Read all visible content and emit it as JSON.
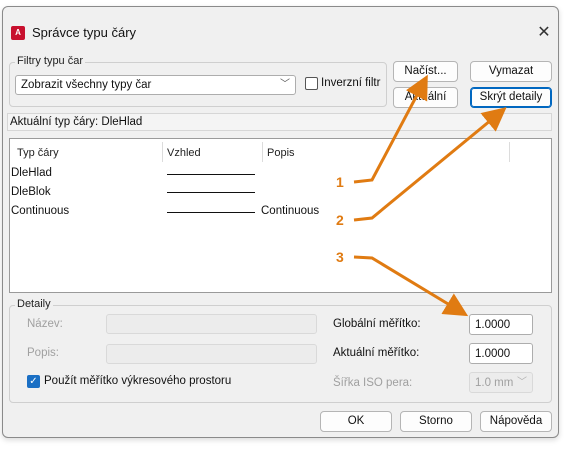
{
  "dialog": {
    "title": "Správce typu čáry",
    "app_icon_text": "A",
    "close_glyph": "✕"
  },
  "filters": {
    "group_label": "Filtry typu čar",
    "selected": "Zobrazit všechny typy čar",
    "invert_label": "Inverzní filtr",
    "invert_checked": false
  },
  "buttons": {
    "load": "Načíst...",
    "delete": "Vymazat",
    "current": "Aktuální",
    "hide_details": "Skrýt detaily",
    "ok": "OK",
    "cancel": "Storno",
    "help": "Nápověda"
  },
  "current_linetype": "Aktuální typ čáry:  DleHlad",
  "table": {
    "columns": [
      "Typ čáry",
      "Vzhled",
      "Popis"
    ],
    "rows": [
      {
        "name": "DleHlad",
        "description": ""
      },
      {
        "name": "DleBlok",
        "description": ""
      },
      {
        "name": "Continuous",
        "description": "Continuous"
      }
    ]
  },
  "details": {
    "group_label": "Detaily",
    "name_label": "Název:",
    "description_label": "Popis:",
    "global_scale_label": "Globální měřítko:",
    "global_scale_value": "1.0000",
    "current_scale_label": "Aktuální měřítko:",
    "current_scale_value": "1.0000",
    "use_paper_space_label": "Použít měřítko výkresového prostoru",
    "use_paper_space_checked": true,
    "iso_pen_label": "Šířka ISO pera:",
    "iso_pen_value": "1.0 mm"
  },
  "callouts": [
    "1",
    "2",
    "3"
  ],
  "colors": {
    "callout": "#e07b12",
    "accent": "#0067c0",
    "app_icon": "#c8102e"
  }
}
